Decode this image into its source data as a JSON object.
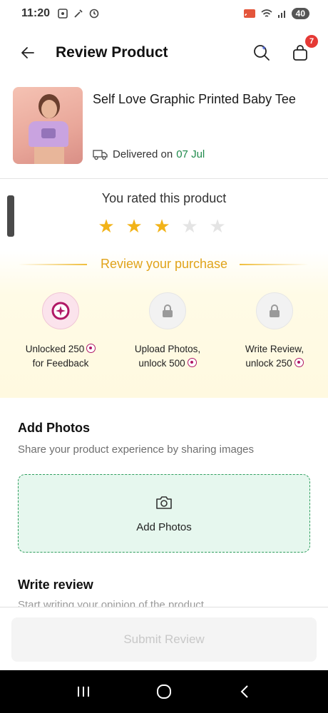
{
  "status_bar": {
    "time": "11:20",
    "battery": "40"
  },
  "header": {
    "title": "Review Product",
    "cart_count": "7"
  },
  "product": {
    "name": "Self Love Graphic Printed Baby Tee",
    "delivered_label": "Delivered on",
    "delivered_date": "07 Jul"
  },
  "rating": {
    "label": "You rated this product",
    "value": 3,
    "max": 5,
    "colors": {
      "filled": "#f2b318",
      "empty": "#e4e4e4"
    }
  },
  "purchase": {
    "heading": "Review your purchase",
    "steps": [
      {
        "line1": "Unlocked 250",
        "line2": "for Feedback",
        "coin_on": 1,
        "icon": "coin-icon"
      },
      {
        "line1": "Upload Photos,",
        "line2": "unlock 500",
        "coin_on": 2,
        "icon": "lock-icon"
      },
      {
        "line1": "Write Review,",
        "line2": "unlock 250",
        "coin_on": 2,
        "icon": "lock-icon"
      }
    ]
  },
  "photos": {
    "title": "Add Photos",
    "subtitle": "Share your product experience by sharing images",
    "button_label": "Add Photos"
  },
  "review": {
    "title": "Write review",
    "placeholder": "Start writing your opinion of the product"
  },
  "submit_label": "Submit Review",
  "accent_colors": {
    "green": "#1f8a4c",
    "gold": "#e0a31a",
    "coin": "#b01866"
  }
}
